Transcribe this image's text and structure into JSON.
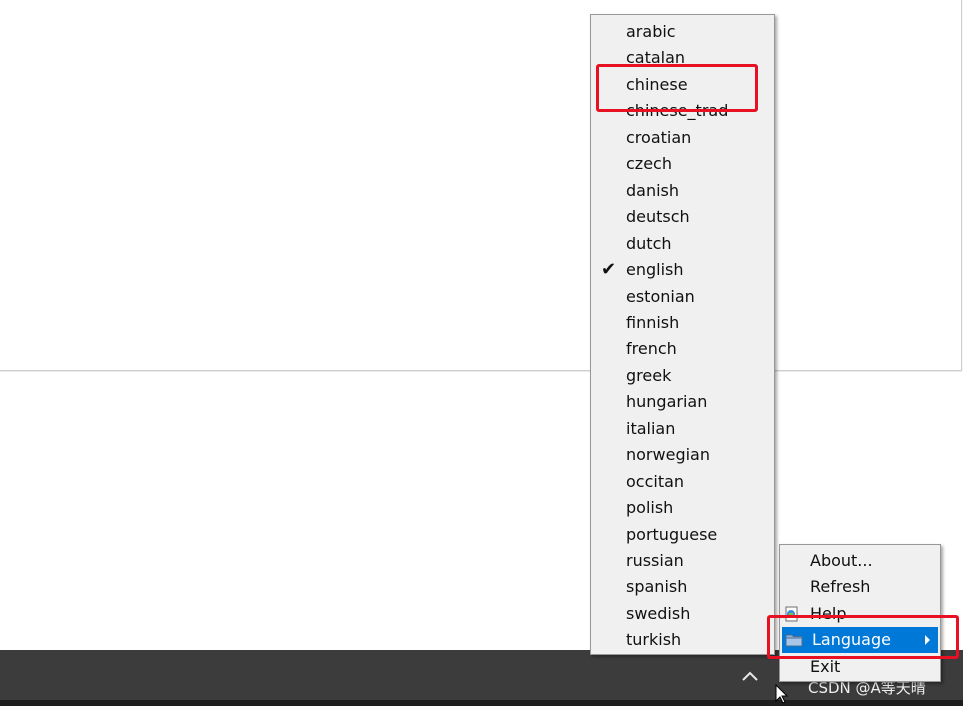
{
  "language_menu": {
    "items": [
      {
        "label": "arabic",
        "checked": false
      },
      {
        "label": "catalan",
        "checked": false
      },
      {
        "label": "chinese",
        "checked": false
      },
      {
        "label": "chinese_trad",
        "checked": false
      },
      {
        "label": "croatian",
        "checked": false
      },
      {
        "label": "czech",
        "checked": false
      },
      {
        "label": "danish",
        "checked": false
      },
      {
        "label": "deutsch",
        "checked": false
      },
      {
        "label": "dutch",
        "checked": false
      },
      {
        "label": "english",
        "checked": true
      },
      {
        "label": "estonian",
        "checked": false
      },
      {
        "label": "finnish",
        "checked": false
      },
      {
        "label": "french",
        "checked": false
      },
      {
        "label": "greek",
        "checked": false
      },
      {
        "label": "hungarian",
        "checked": false
      },
      {
        "label": "italian",
        "checked": false
      },
      {
        "label": "norwegian",
        "checked": false
      },
      {
        "label": "occitan",
        "checked": false
      },
      {
        "label": "polish",
        "checked": false
      },
      {
        "label": "portuguese",
        "checked": false
      },
      {
        "label": "russian",
        "checked": false
      },
      {
        "label": "spanish",
        "checked": false
      },
      {
        "label": "swedish",
        "checked": false
      },
      {
        "label": "turkish",
        "checked": false
      }
    ],
    "check_glyph": "✔"
  },
  "tray_menu": {
    "items": [
      {
        "label": "About...",
        "icon": "",
        "selected": false
      },
      {
        "label": "Refresh",
        "icon": "",
        "selected": false
      },
      {
        "label": "Help",
        "icon": "help-document-icon",
        "selected": false
      },
      {
        "label": "Language",
        "icon": "folder-icon",
        "selected": true,
        "submenu": true
      },
      {
        "label": "Exit",
        "icon": "",
        "selected": false
      }
    ]
  },
  "watermark": {
    "text": "CSDN @A等天晴"
  },
  "colors": {
    "selection": "#0078d7",
    "annotation": "#e81123",
    "menu_bg": "#f0f0f0",
    "taskbar": "#3c3c3c"
  }
}
